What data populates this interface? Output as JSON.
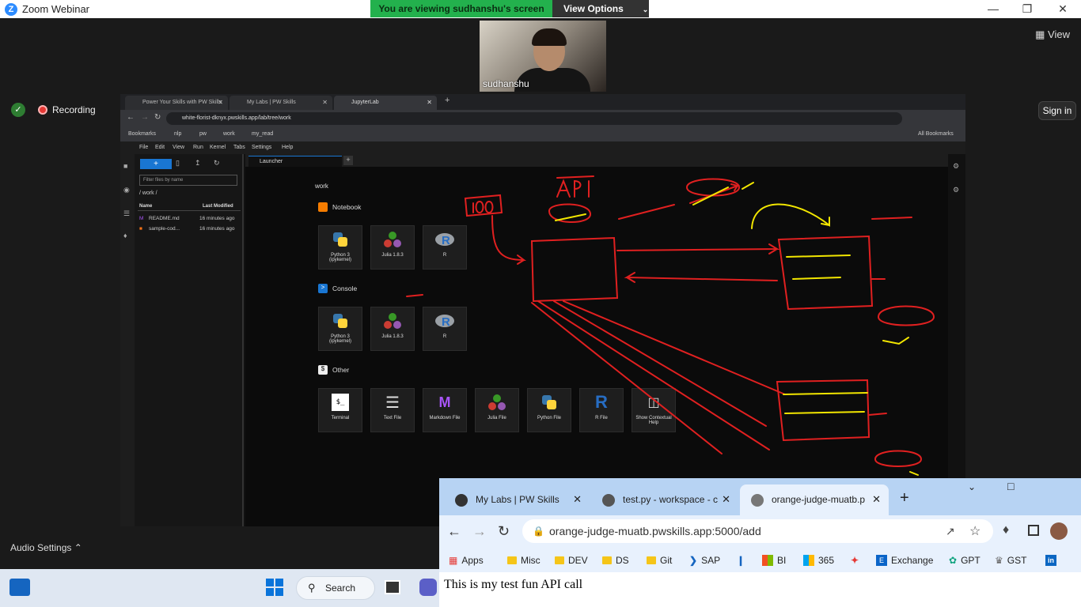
{
  "zoom": {
    "title": "Zoom Webinar",
    "viewing_banner": "You are viewing sudhanshu's screen",
    "view_options": "View Options",
    "view_button": "View",
    "recording": "Recording",
    "sign_in": "Sign in",
    "participant_name": "sudhanshu",
    "audio_settings": "Audio Settings"
  },
  "shared_browser": {
    "tabs": [
      {
        "label": "Power Your Skills with PW Skills"
      },
      {
        "label": "My Labs | PW Skills"
      },
      {
        "label": "JupyterLab"
      }
    ],
    "url": "white-florist-dknyx.pwskills.app/lab/tree/work",
    "bookmarks": [
      "Bookmarks",
      "nlp",
      "pw",
      "work",
      "my_read"
    ],
    "all_bookmarks": "All Bookmarks"
  },
  "jupyter": {
    "menu": [
      "File",
      "Edit",
      "View",
      "Run",
      "Kernel",
      "Tabs",
      "Settings",
      "Help"
    ],
    "filter_placeholder": "Filter files by name",
    "breadcrumb": "/ work /",
    "columns": {
      "name": "Name",
      "modified": "Last Modified"
    },
    "files": [
      {
        "name": "README.md",
        "modified": "16 minutes ago"
      },
      {
        "name": "sample-cod...",
        "modified": "16 minutes ago"
      }
    ],
    "tab": "Launcher",
    "folder": "work",
    "sections": {
      "notebook": "Notebook",
      "console": "Console",
      "other": "Other"
    },
    "notebook_cards": [
      {
        "label": "Python 3\n(ipykernel)"
      },
      {
        "label": "Julia 1.8.3"
      },
      {
        "label": "R"
      }
    ],
    "console_cards": [
      {
        "label": "Python 3\n(ipykernel)"
      },
      {
        "label": "Julia 1.8.3"
      },
      {
        "label": "R"
      }
    ],
    "other_cards": [
      {
        "label": "Terminal"
      },
      {
        "label": "Text File"
      },
      {
        "label": "Markdown File"
      },
      {
        "label": "Julia File"
      },
      {
        "label": "Python File"
      },
      {
        "label": "R File"
      },
      {
        "label": "Show Contextual Help"
      }
    ]
  },
  "browser2": {
    "tabs": [
      {
        "label": "My Labs | PW Skills"
      },
      {
        "label": "test.py - workspace - c"
      },
      {
        "label": "orange-judge-muatb.p"
      }
    ],
    "url": "orange-judge-muatb.pwskills.app:5000/add",
    "bookmarks": [
      "Apps",
      "Misc",
      "DEV",
      "DS",
      "Git",
      "SAP",
      "BI",
      "365",
      "Exchange",
      "GPT",
      "GST"
    ],
    "page_text": "This is my test fun API call"
  },
  "taskbar": {
    "search": "Search"
  },
  "colors": {
    "zoom_green": "#23b14d",
    "ink_red": "#e02020",
    "ink_yellow": "#f2e600",
    "jupyter_blue": "#1976d2"
  }
}
